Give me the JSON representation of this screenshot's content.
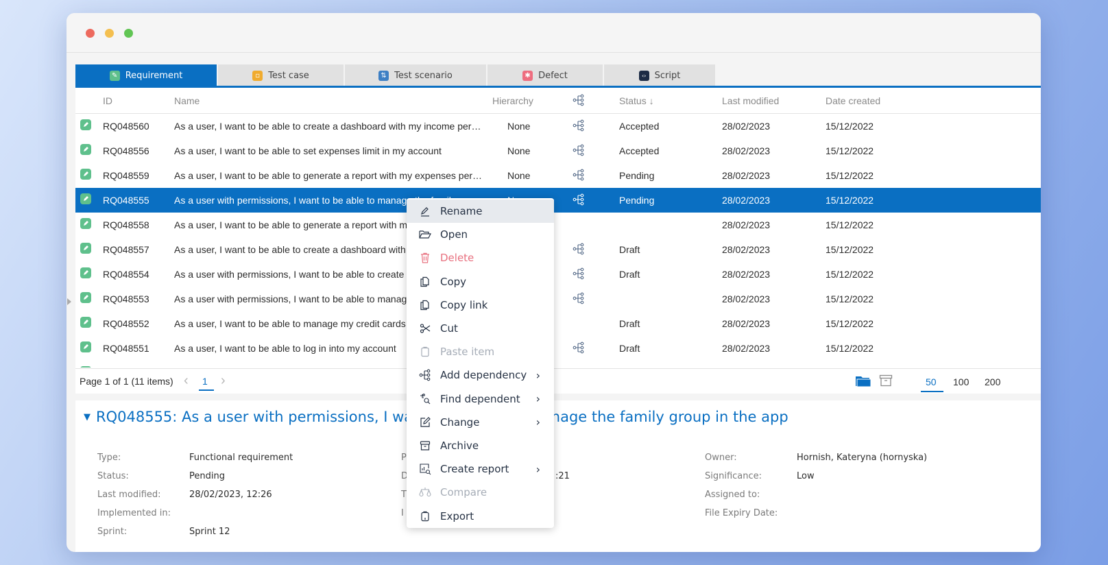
{
  "window": {
    "traffic_lights": [
      "close",
      "minimize",
      "maximize"
    ]
  },
  "tabs": [
    {
      "label": "Requirement",
      "icon": "requirement-icon",
      "color": "#5fc08c",
      "active": true
    },
    {
      "label": "Test case",
      "icon": "test-case-icon",
      "color": "#f0ab2e",
      "active": false
    },
    {
      "label": "Test scenario",
      "icon": "test-scenario-icon",
      "color": "#3d7fc4",
      "active": false
    },
    {
      "label": "Defect",
      "icon": "defect-icon",
      "color": "#ee6d7f",
      "active": false
    },
    {
      "label": "Script",
      "icon": "script-icon",
      "color": "#1d2b45",
      "active": false
    }
  ],
  "grid": {
    "columns": {
      "id": "ID",
      "name": "Name",
      "hierarchy": "Hierarchy",
      "dependency_icon": "dependency-tree-icon",
      "status": "Status",
      "status_sort": "↓",
      "last_modified": "Last modified",
      "date_created": "Date created"
    },
    "rows": [
      {
        "id": "RQ048560",
        "name": "As a user, I want to be able to create a dashboard with my income per…",
        "hierarchy": "None",
        "tree": true,
        "status": "Accepted",
        "last_modified": "28/02/2023",
        "date_created": "15/12/2022",
        "selected": false
      },
      {
        "id": "RQ048556",
        "name": "As a user, I want to be able to set expenses limit in my account",
        "hierarchy": "None",
        "tree": true,
        "status": "Accepted",
        "last_modified": "28/02/2023",
        "date_created": "15/12/2022",
        "selected": false
      },
      {
        "id": "RQ048559",
        "name": "As a user, I want to be able to generate a report with my expenses per…",
        "hierarchy": "None",
        "tree": true,
        "status": "Pending",
        "last_modified": "28/02/2023",
        "date_created": "15/12/2022",
        "selected": false
      },
      {
        "id": "RQ048555",
        "name": "As a user with permissions, I want to be able to manage the family gro…",
        "hierarchy": "None",
        "tree": true,
        "status": "Pending",
        "last_modified": "28/02/2023",
        "date_created": "15/12/2022",
        "selected": true
      },
      {
        "id": "RQ048558",
        "name": "As a user, I want to be able to generate a report with my",
        "hierarchy": "",
        "tree": false,
        "status": "",
        "last_modified": "28/02/2023",
        "date_created": "15/12/2022",
        "selected": false
      },
      {
        "id": "RQ048557",
        "name": "As a user, I want to be able to create a dashboard with",
        "hierarchy": "",
        "tree": true,
        "status": "Draft",
        "last_modified": "28/02/2023",
        "date_created": "15/12/2022",
        "selected": false
      },
      {
        "id": "RQ048554",
        "name": "As a user with permissions, I want to be able to create",
        "hierarchy": "",
        "tree": true,
        "status": "Draft",
        "last_modified": "28/02/2023",
        "date_created": "15/12/2022",
        "selected": false
      },
      {
        "id": "RQ048553",
        "name": "As a user with permissions, I want to be able to manag",
        "hierarchy": "",
        "tree": true,
        "status": "",
        "last_modified": "28/02/2023",
        "date_created": "15/12/2022",
        "selected": false
      },
      {
        "id": "RQ048552",
        "name": "As a user, I want to be able to manage my credit cards",
        "hierarchy": "",
        "tree": false,
        "status": "Draft",
        "last_modified": "28/02/2023",
        "date_created": "15/12/2022",
        "selected": false
      },
      {
        "id": "RQ048551",
        "name": "As a user, I want to be able to log in into my account",
        "hierarchy": "",
        "tree": true,
        "status": "Draft",
        "last_modified": "28/02/2023",
        "date_created": "15/12/2022",
        "selected": false
      }
    ]
  },
  "pager": {
    "summary": "Page 1 of 1 (11 items)",
    "prev": "‹",
    "current_page": "1",
    "next": "›",
    "page_sizes": [
      "50",
      "100",
      "200"
    ],
    "active_page_size": "50"
  },
  "details": {
    "title": "RQ048555: As a user with permissions, I want to be able to manage the family group in the app",
    "left_fields": [
      {
        "label": "Type:",
        "value": "Functional requirement"
      },
      {
        "label": "Status:",
        "value": "Pending"
      },
      {
        "label": "Last modified:",
        "value": "28/02/2023, 12:26"
      },
      {
        "label": "Implemented in:",
        "value": ""
      },
      {
        "label": "Sprint:",
        "value": "Sprint 12"
      }
    ],
    "middle_fields_partial": [
      {
        "label": "P",
        "value": ""
      },
      {
        "label": "D",
        "value": ":21"
      },
      {
        "label": "T",
        "value": ""
      },
      {
        "label": "I",
        "value": ""
      }
    ],
    "right_fields": [
      {
        "label": "Owner:",
        "value": "Hornish, Kateryna (hornyska)"
      },
      {
        "label": "Significance:",
        "value": "Low"
      },
      {
        "label": "Assigned to:",
        "value": ""
      },
      {
        "label": "File Expiry Date:",
        "value": ""
      }
    ]
  },
  "context_menu": {
    "items": [
      {
        "label": "Rename",
        "icon": "pencil-icon",
        "state": "hover",
        "submenu": false
      },
      {
        "label": "Open",
        "icon": "folder-open-icon",
        "state": "normal",
        "submenu": false
      },
      {
        "label": "Delete",
        "icon": "trash-icon",
        "state": "danger",
        "submenu": false
      },
      {
        "label": "Copy",
        "icon": "copy-icon",
        "state": "normal",
        "submenu": false
      },
      {
        "label": "Copy link",
        "icon": "copy-link-icon",
        "state": "normal",
        "submenu": false
      },
      {
        "label": "Cut",
        "icon": "scissors-icon",
        "state": "normal",
        "submenu": false
      },
      {
        "label": "Paste item",
        "icon": "clipboard-icon",
        "state": "disabled",
        "submenu": false
      },
      {
        "label": "Add dependency",
        "icon": "dependency-tree-icon",
        "state": "normal",
        "submenu": true
      },
      {
        "label": "Find dependent",
        "icon": "find-dependent-icon",
        "state": "normal",
        "submenu": true
      },
      {
        "label": "Change",
        "icon": "edit-box-icon",
        "state": "normal",
        "submenu": true
      },
      {
        "label": "Archive",
        "icon": "archive-icon",
        "state": "normal",
        "submenu": false
      },
      {
        "label": "Create report",
        "icon": "report-icon",
        "state": "normal",
        "submenu": true
      },
      {
        "label": "Compare",
        "icon": "scales-icon",
        "state": "disabled",
        "submenu": false
      },
      {
        "label": "Export",
        "icon": "export-icon",
        "state": "normal",
        "submenu": false
      }
    ],
    "submenu_glyph": "›"
  },
  "colors": {
    "accent": "#0a6fc2",
    "requirement_green": "#5fc08c",
    "danger": "#e8707f",
    "disabled": "#a6adb7"
  }
}
